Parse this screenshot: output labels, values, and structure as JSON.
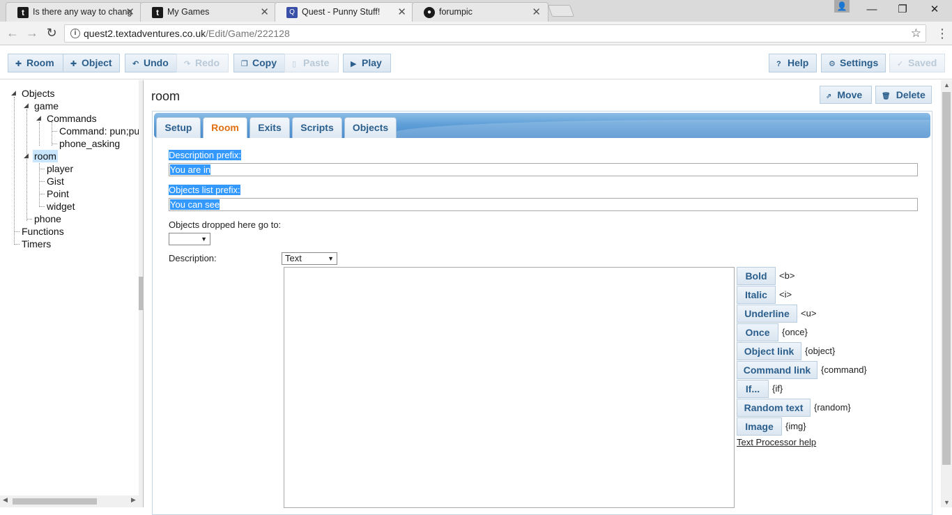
{
  "browser": {
    "tabs": [
      {
        "title": "Is there any way to chang",
        "favicon": "t-icon"
      },
      {
        "title": "My Games",
        "favicon": "t-icon"
      },
      {
        "title": "Quest - Punny Stuff!",
        "favicon": "quest-icon"
      },
      {
        "title": "forumpic",
        "favicon": "github-icon"
      }
    ],
    "url_host": "quest2.textadventures.co.uk",
    "url_path": "/Edit/Game/222128"
  },
  "toolbar": {
    "room": "Room",
    "object": "Object",
    "undo": "Undo",
    "redo": "Redo",
    "copy": "Copy",
    "paste": "Paste",
    "play": "Play",
    "help": "Help",
    "settings": "Settings",
    "saved": "Saved"
  },
  "tree": {
    "objects": "Objects",
    "game": "game",
    "commands": "Commands",
    "command_pun": "Command: pun;pun",
    "phone_asking": "phone_asking",
    "room": "room",
    "player": "player",
    "gist": "Gist",
    "point": "Point",
    "widget": "widget",
    "phone": "phone",
    "functions": "Functions",
    "timers": "Timers"
  },
  "editor": {
    "title": "room",
    "move": "Move",
    "delete": "Delete",
    "tabs": [
      "Setup",
      "Room",
      "Exits",
      "Scripts",
      "Objects"
    ],
    "active_tab": "Room",
    "desc_prefix_label": "Description prefix:",
    "desc_prefix_value": "You are in",
    "objlist_prefix_label": "Objects list prefix:",
    "objlist_prefix_value": "You can see",
    "dropped_label": "Objects dropped here go to:",
    "dropped_value": "",
    "description_label": "Description:",
    "description_type": "Text",
    "text_processor": [
      {
        "label": "Bold",
        "tag": "<b>"
      },
      {
        "label": "Italic",
        "tag": "<i>"
      },
      {
        "label": "Underline",
        "tag": "<u>"
      },
      {
        "label": "Once",
        "tag": "{once}"
      },
      {
        "label": "Object link",
        "tag": "{object}"
      },
      {
        "label": "Command link",
        "tag": "{command}"
      },
      {
        "label": "If...",
        "tag": "{if}"
      },
      {
        "label": "Random text",
        "tag": "{random}"
      },
      {
        "label": "Image",
        "tag": "{img}"
      }
    ],
    "help_link": "Text Processor help"
  }
}
